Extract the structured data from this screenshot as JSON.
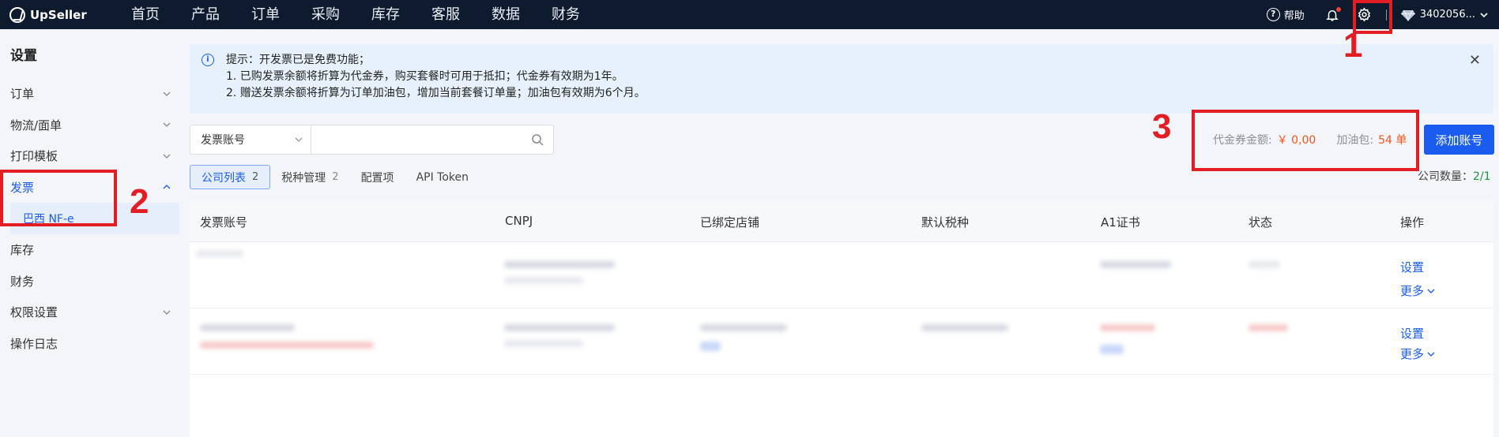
{
  "app": {
    "logo": "UpSeller",
    "nav": [
      "首页",
      "产品",
      "订单",
      "采购",
      "库存",
      "客服",
      "数据",
      "财务"
    ],
    "help": "帮助",
    "user": "3402056..."
  },
  "sidebar": {
    "title": "设置",
    "items": [
      {
        "label": "订单",
        "expandable": true
      },
      {
        "label": "物流/面单",
        "expandable": true
      },
      {
        "label": "打印模板",
        "expandable": true
      },
      {
        "label": "发票",
        "expandable": true,
        "expanded": true
      },
      {
        "label": "库存",
        "expandable": false
      },
      {
        "label": "财务",
        "expandable": false
      },
      {
        "label": "权限设置",
        "expandable": true
      },
      {
        "label": "操作日志",
        "expandable": false
      }
    ],
    "sub_item": "巴西 NF-e"
  },
  "notice": {
    "line1": "提示：开发票已是免费功能；",
    "line2": "1. 已购发票余额将折算为代金券，购买套餐时可用于抵扣；代金券有效期为1年。",
    "line3": "2. 赠送发票余额将折算为订单加油包，增加当前套餐订单量；加油包有效期为6个月。"
  },
  "search": {
    "select_value": "发票账号",
    "placeholder": ""
  },
  "balances": {
    "voucher_label": "代金券金额:",
    "voucher_value": "￥ 0,00",
    "fuel_label": "加油包:",
    "fuel_value": "54 单"
  },
  "add_button": "添加账号",
  "tabs": [
    {
      "label": "公司列表",
      "count": "2",
      "active": true
    },
    {
      "label": "税种管理",
      "count": "2",
      "active": false
    },
    {
      "label": "配置项",
      "count": "",
      "active": false
    },
    {
      "label": "API Token",
      "count": "",
      "active": false
    }
  ],
  "company_count": {
    "label": "公司数量：",
    "value": "2/1"
  },
  "table": {
    "columns": [
      "发票账号",
      "CNPJ",
      "已绑定店铺",
      "默认税种",
      "A1证书",
      "状态",
      "操作"
    ],
    "rows": [
      {
        "op_set": "设置",
        "op_more": "更多"
      },
      {
        "op_set": "设置",
        "op_more": "更多"
      }
    ]
  },
  "annotations": [
    "1",
    "2",
    "3"
  ],
  "colors": {
    "topbar": "#0e1a2e",
    "primary": "#1a5cf0",
    "annotation": "#e31d24",
    "orange": "#f2551c"
  }
}
